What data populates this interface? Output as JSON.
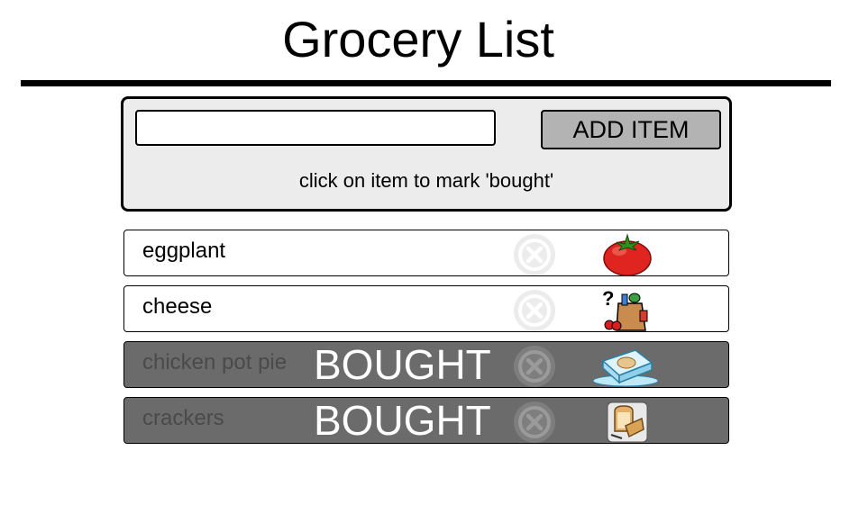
{
  "app": {
    "title": "Grocery List"
  },
  "form": {
    "input_value": "",
    "input_placeholder": "",
    "add_label": "ADD ITEM",
    "hint": "click on item to mark 'bought'"
  },
  "items": [
    {
      "name": "eggplant",
      "bought": false,
      "bought_label": "",
      "icon": "tomato-icon"
    },
    {
      "name": "cheese",
      "bought": false,
      "bought_label": "",
      "icon": "grocery-bag-icon"
    },
    {
      "name": "chicken pot pie",
      "bought": true,
      "bought_label": "BOUGHT",
      "icon": "frozen-food-icon"
    },
    {
      "name": "crackers",
      "bought": true,
      "bought_label": "BOUGHT",
      "icon": "bread-icon"
    }
  ],
  "colors": {
    "bought_row": "#6b6b6b",
    "panel_bg": "#ececec",
    "add_button_bg": "#b3b3b3"
  }
}
